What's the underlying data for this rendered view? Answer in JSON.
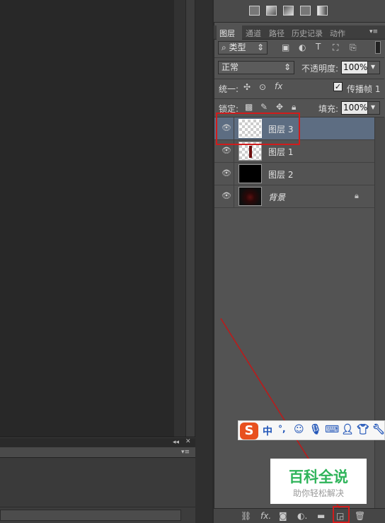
{
  "layers_panel": {
    "tabs": [
      "图层",
      "通道",
      "路径",
      "历史记录",
      "动作"
    ],
    "filter": {
      "kind_label": "类型"
    },
    "blend_mode": "正常",
    "opacity_label": "不透明度:",
    "opacity_value": "100%",
    "unify_label": "统一:",
    "propagate_label": "传播帧 1",
    "lock_label": "锁定:",
    "fill_label": "填充:",
    "fill_value": "100%",
    "layers": [
      {
        "name": "图层 3",
        "selected": true,
        "thumb": "transparent"
      },
      {
        "name": "图层 1",
        "selected": false,
        "thumb": "bottle"
      },
      {
        "name": "图层 2",
        "selected": false,
        "thumb": "black"
      },
      {
        "name": "背景",
        "selected": false,
        "thumb": "photo",
        "locked": true
      }
    ]
  },
  "ime_bar": {
    "items": [
      "中",
      "°,"
    ]
  },
  "watermark": {
    "title": "百科全说",
    "subtitle": "助你轻松解决"
  },
  "colors": {
    "panel": "#535353",
    "selected_layer": "#5d6d82",
    "highlight": "#d01c1c",
    "watermark_green": "#2fb45a"
  }
}
